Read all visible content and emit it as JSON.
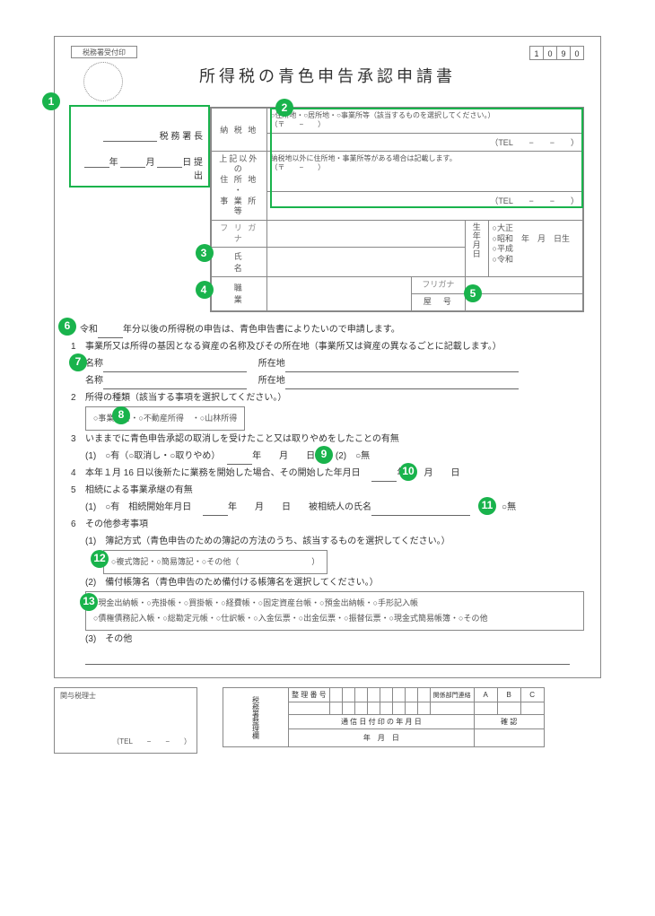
{
  "header": {
    "stamp_label": "税務署受付印",
    "title": "所得税の青色申告承認申請書",
    "form_number": [
      "1",
      "0",
      "9",
      "0"
    ]
  },
  "left": {
    "tax_office_suffix": "税 務 署 長",
    "date_suffix": "提 出",
    "y": "年",
    "m": "月",
    "d": "日"
  },
  "addr": {
    "row1_label": "納 税 地",
    "row1_options": "○住所地・○居所地・○事業所等（該当するものを選択してください。）",
    "postal": "（〒　　−　　）",
    "tel": "（TEL　　−　　−　　）",
    "row2_label_line1": "上記以外の",
    "row2_label_line2": "住 所 地 ・",
    "row2_label_line3": "事 業 所 等",
    "row2_note": "納税地以外に住所地・事業所等がある場合は記載します。",
    "furigana": "フ リ ガ ナ",
    "name_label": "氏　　　名",
    "birth_label": "生年月日",
    "era1": "○大正",
    "era2": "○昭和",
    "era3": "○平成",
    "era4": "○令和",
    "birth_tail": "年　月　日生",
    "occ_label": "職　　　業",
    "yago_furi": "フリガナ",
    "yago_label": "屋　号"
  },
  "body": {
    "b6_pre": "令和",
    "b6_post": "年分以後の所得税の申告は、青色申告書によりたいので申請します。",
    "s1": "事業所又は所得の基因となる資産の名称及びその所在地（事業所又は資産の異なるごとに記載します。）",
    "name_lbl": "名称",
    "loc_lbl": "所在地",
    "s2": "所得の種類（該当する事項を選択してください。）",
    "s2_opts": "○事業所得・○不動産所得　・○山林所得",
    "s3": "いままでに青色申告承認の取消しを受けたこと又は取りやめをしたことの有無",
    "s3_1": "(1)　○有（○取消し・○取りやめ）",
    "s3_tail": "年　　月　　日",
    "s3_2": "(2)　○無",
    "s4": "本年１月 16 日以後新たに業務を開始した場合、その開始した年月日",
    "s4_tail": "年　　月　　日",
    "s5": "相続による事業承継の有無",
    "s5_1": "(1)　○有　相続開始年月日",
    "s5_mid": "年　　月　　日　　被相続人の氏名",
    "s5_2": "(2)　○無",
    "s6": "その他参考事項",
    "s6_1": "(1)　簿記方式（青色申告のための簿記の方法のうち、該当するものを選択してください。）",
    "s6_1_opts": "○複式簿記・○簡易簿記・○その他（　　　　　　　　　）",
    "s6_2": "(2)　備付帳簿名（青色申告のため備付ける帳簿名を選択してください。）",
    "s6_2_opts1": "○現金出納帳・○売掛帳・○買掛帳・○経費帳・○固定資産台帳・○預金出納帳・○手形記入帳",
    "s6_2_opts2": "○債権債務記入帳・○総勘定元帳・○仕訳帳・○入金伝票・○出金伝票・○振替伝票・○現金式簡易帳簿・○その他",
    "s6_3": "(3)　その他"
  },
  "bottom": {
    "zeirishi": "関与税理士",
    "zeirishi_tel": "（TEL　　−　　−　　）",
    "col1": "税務署整理欄",
    "seiri": "整 理 番 号",
    "kankei": "関係部門連絡",
    "a": "A",
    "b": "B",
    "c": "C",
    "tsushin": "通 信 日 付 印 の 年 月 日",
    "kakunin": "確 認",
    "ymd": "年　月　日"
  }
}
